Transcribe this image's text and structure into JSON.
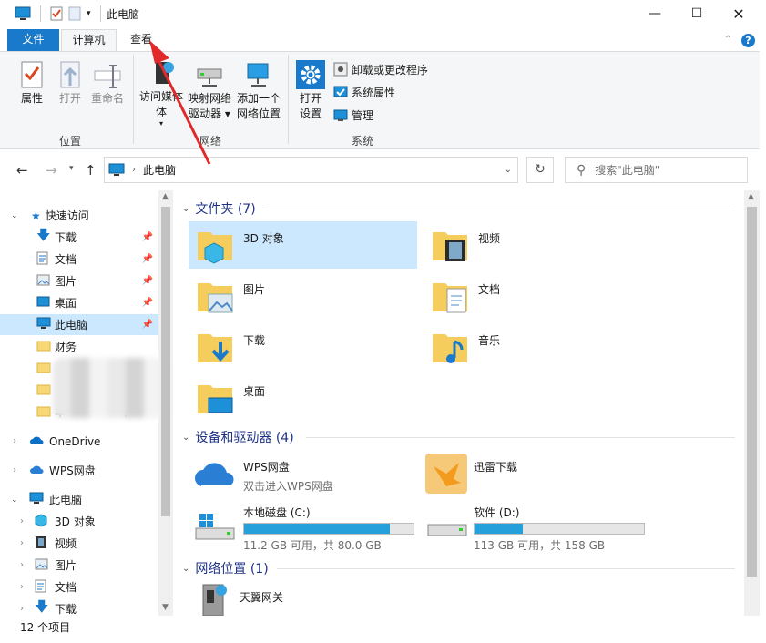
{
  "window": {
    "title": "此电脑"
  },
  "ribbon_tabs": {
    "file": "文件",
    "computer": "计算机",
    "view": "查看"
  },
  "ribbon": {
    "location": {
      "label": "位置",
      "properties": "属性",
      "open": "打开",
      "rename": "重命名"
    },
    "network": {
      "label": "网络",
      "access_media_1": "访问媒体",
      "access_media_2": "体",
      "map_drive_1": "映射网络",
      "map_drive_2": "驱动器",
      "add_location_1": "添加一个",
      "add_location_2": "网络位置"
    },
    "system": {
      "label": "系统",
      "open_settings_1": "打开",
      "open_settings_2": "设置",
      "uninstall": "卸载或更改程序",
      "sys_props": "系统属性",
      "manage": "管理"
    }
  },
  "address": {
    "path": "此电脑",
    "search_placeholder": "搜索\"此电脑\""
  },
  "nav": {
    "quick_access": "快速访问",
    "items": [
      "下载",
      "文档",
      "图片",
      "桌面",
      "此电脑",
      "财务",
      "丰",
      "千"
    ],
    "onedrive": "OneDrive",
    "wps": "WPS网盘",
    "this_pc": "此电脑",
    "pc_items": [
      "3D 对象",
      "视频",
      "图片",
      "文档",
      "下载"
    ]
  },
  "sections": {
    "folders": "文件夹 (7)",
    "devices": "设备和驱动器 (4)",
    "network": "网络位置 (1)"
  },
  "folders": [
    "3D 对象",
    "视频",
    "图片",
    "文档",
    "下载",
    "音乐",
    "桌面"
  ],
  "devices": {
    "wps_name": "WPS网盘",
    "wps_sub": "双击进入WPS网盘",
    "xunlei": "迅雷下载",
    "drive_c_name": "本地磁盘 (C:)",
    "drive_c_info": "11.2 GB 可用，共 80.0 GB",
    "drive_c_used": 0.86,
    "drive_d_name": "软件 (D:)",
    "drive_d_info": "113 GB 可用，共 158 GB",
    "drive_d_used": 0.285
  },
  "network_locations": [
    "天翼网关"
  ],
  "status": {
    "count": "12 个项目"
  },
  "colors": {
    "accent": "#1979ca",
    "selection": "#cce3f7",
    "bar": "#26a0da",
    "arrow": "#e0292a"
  }
}
